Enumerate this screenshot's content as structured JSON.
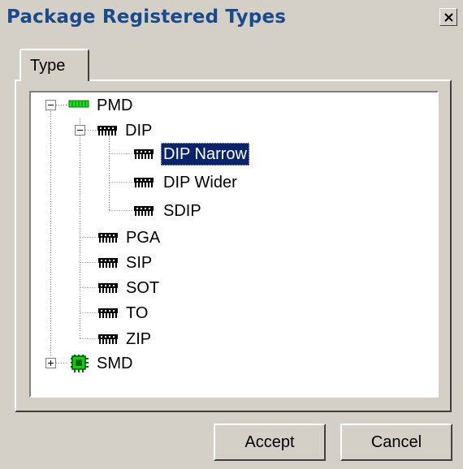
{
  "window": {
    "title": "Package Registered Types",
    "close_symbol": "×"
  },
  "tabs": [
    {
      "label": "Type",
      "active": true
    }
  ],
  "tree": {
    "nodes": [
      {
        "label": "PMD",
        "icon": "pmd-package-icon",
        "expanded": true
      },
      {
        "label": "DIP",
        "icon": "dip-chip-icon",
        "expanded": true
      },
      {
        "label": "DIP Narrow",
        "icon": "dip-chip-icon",
        "selected": true
      },
      {
        "label": "DIP Wider",
        "icon": "dip-chip-icon"
      },
      {
        "label": "SDIP",
        "icon": "dip-chip-icon"
      },
      {
        "label": "PGA",
        "icon": "dip-chip-icon"
      },
      {
        "label": "SIP",
        "icon": "dip-chip-icon"
      },
      {
        "label": "SOT",
        "icon": "dip-chip-icon"
      },
      {
        "label": "TO",
        "icon": "dip-chip-icon"
      },
      {
        "label": "ZIP",
        "icon": "dip-chip-icon"
      },
      {
        "label": "SMD",
        "icon": "smd-chip-icon",
        "expanded": false
      }
    ]
  },
  "buttons": {
    "accept": "Accept",
    "cancel": "Cancel"
  },
  "colors": {
    "title_text": "#1a4a8a",
    "face": "#d4d0c8",
    "selection": "#0a246a",
    "pmd_icon": "#22dd22",
    "smd_icon": "#11cc11"
  }
}
